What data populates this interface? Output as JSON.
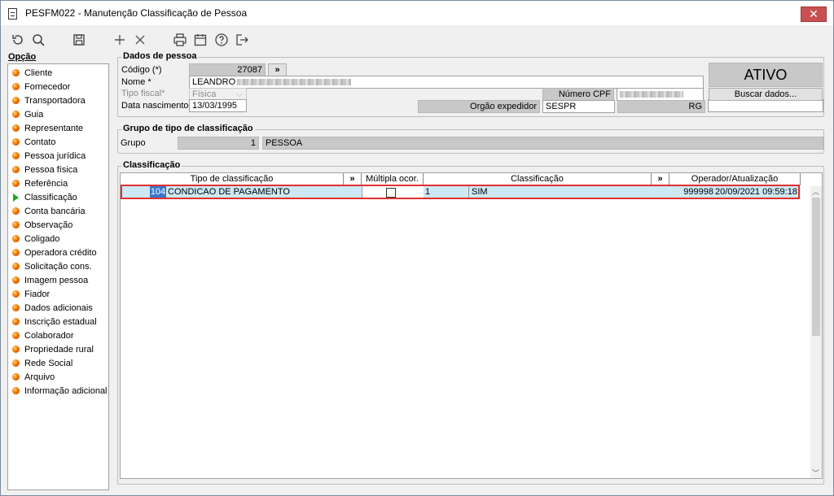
{
  "window": {
    "title": "PESFM022 - Manutenção Classificação de Pessoa",
    "close_label": "✕"
  },
  "toolbar": {
    "buttons": [
      "refresh-icon",
      "search-icon",
      "save-icon",
      "add-icon",
      "delete-icon",
      "print-icon",
      "calendar-icon",
      "help-icon",
      "exit-icon"
    ]
  },
  "sidebar": {
    "header": "Opção",
    "items": [
      {
        "label": "Cliente"
      },
      {
        "label": "Fornecedor"
      },
      {
        "label": "Transportadora"
      },
      {
        "label": "Guia"
      },
      {
        "label": "Representante"
      },
      {
        "label": "Contato"
      },
      {
        "label": "Pessoa jurídica"
      },
      {
        "label": "Pessoa física"
      },
      {
        "label": "Referência"
      },
      {
        "label": "Classificação",
        "active": true
      },
      {
        "label": "Conta bancária"
      },
      {
        "label": "Observação"
      },
      {
        "label": "Coligado"
      },
      {
        "label": "Operadora crédito"
      },
      {
        "label": "Solicitação cons."
      },
      {
        "label": "Imagem pessoa"
      },
      {
        "label": "Fiador"
      },
      {
        "label": "Dados adicionais"
      },
      {
        "label": "Inscrição estadual"
      },
      {
        "label": "Colaborador"
      },
      {
        "label": "Propriedade rural"
      },
      {
        "label": "Rede Social"
      },
      {
        "label": "Arquivo"
      },
      {
        "label": "Informação adicional"
      }
    ]
  },
  "dados": {
    "title": "Dados de pessoa",
    "codigo_label": "Código (*)",
    "codigo_value": "27087",
    "more_label": "»",
    "nome_label": "Nome *",
    "nome_value": "LEANDRO",
    "tipo_fiscal_label": "Tipo fiscal*",
    "tipo_fiscal_value": "Física",
    "data_nasc_label": "Data nascimento",
    "data_nasc_value": "13/03/1995",
    "cpf_label": "Número CPF",
    "orgao_label": "Orgão expedidor",
    "orgao_value": "SESPR",
    "rg_label": "RG",
    "status": "ATIVO",
    "buscar_label": "Buscar dados..."
  },
  "grupo": {
    "title": "Grupo de tipo de classificação",
    "label": "Grupo",
    "code": "1",
    "name": "PESSOA"
  },
  "classificacao": {
    "title": "Classificação",
    "columns": [
      "Tipo de classificação",
      "»",
      "Múltipla ocor.",
      "Classificação",
      "»",
      "Operador/Atualização"
    ],
    "rows": [
      {
        "tipo_code": "104",
        "tipo_name": "CONDICAO DE PAGAMENTO",
        "multipla": false,
        "class_code": "1",
        "class_name": "SIM",
        "operador": "999998",
        "atualizacao": "20/09/2021 09:59:18"
      }
    ]
  },
  "colors": {
    "selected_row": "#cde8f8",
    "highlight": "#e03030",
    "active_arrow": "#1ea81e"
  }
}
